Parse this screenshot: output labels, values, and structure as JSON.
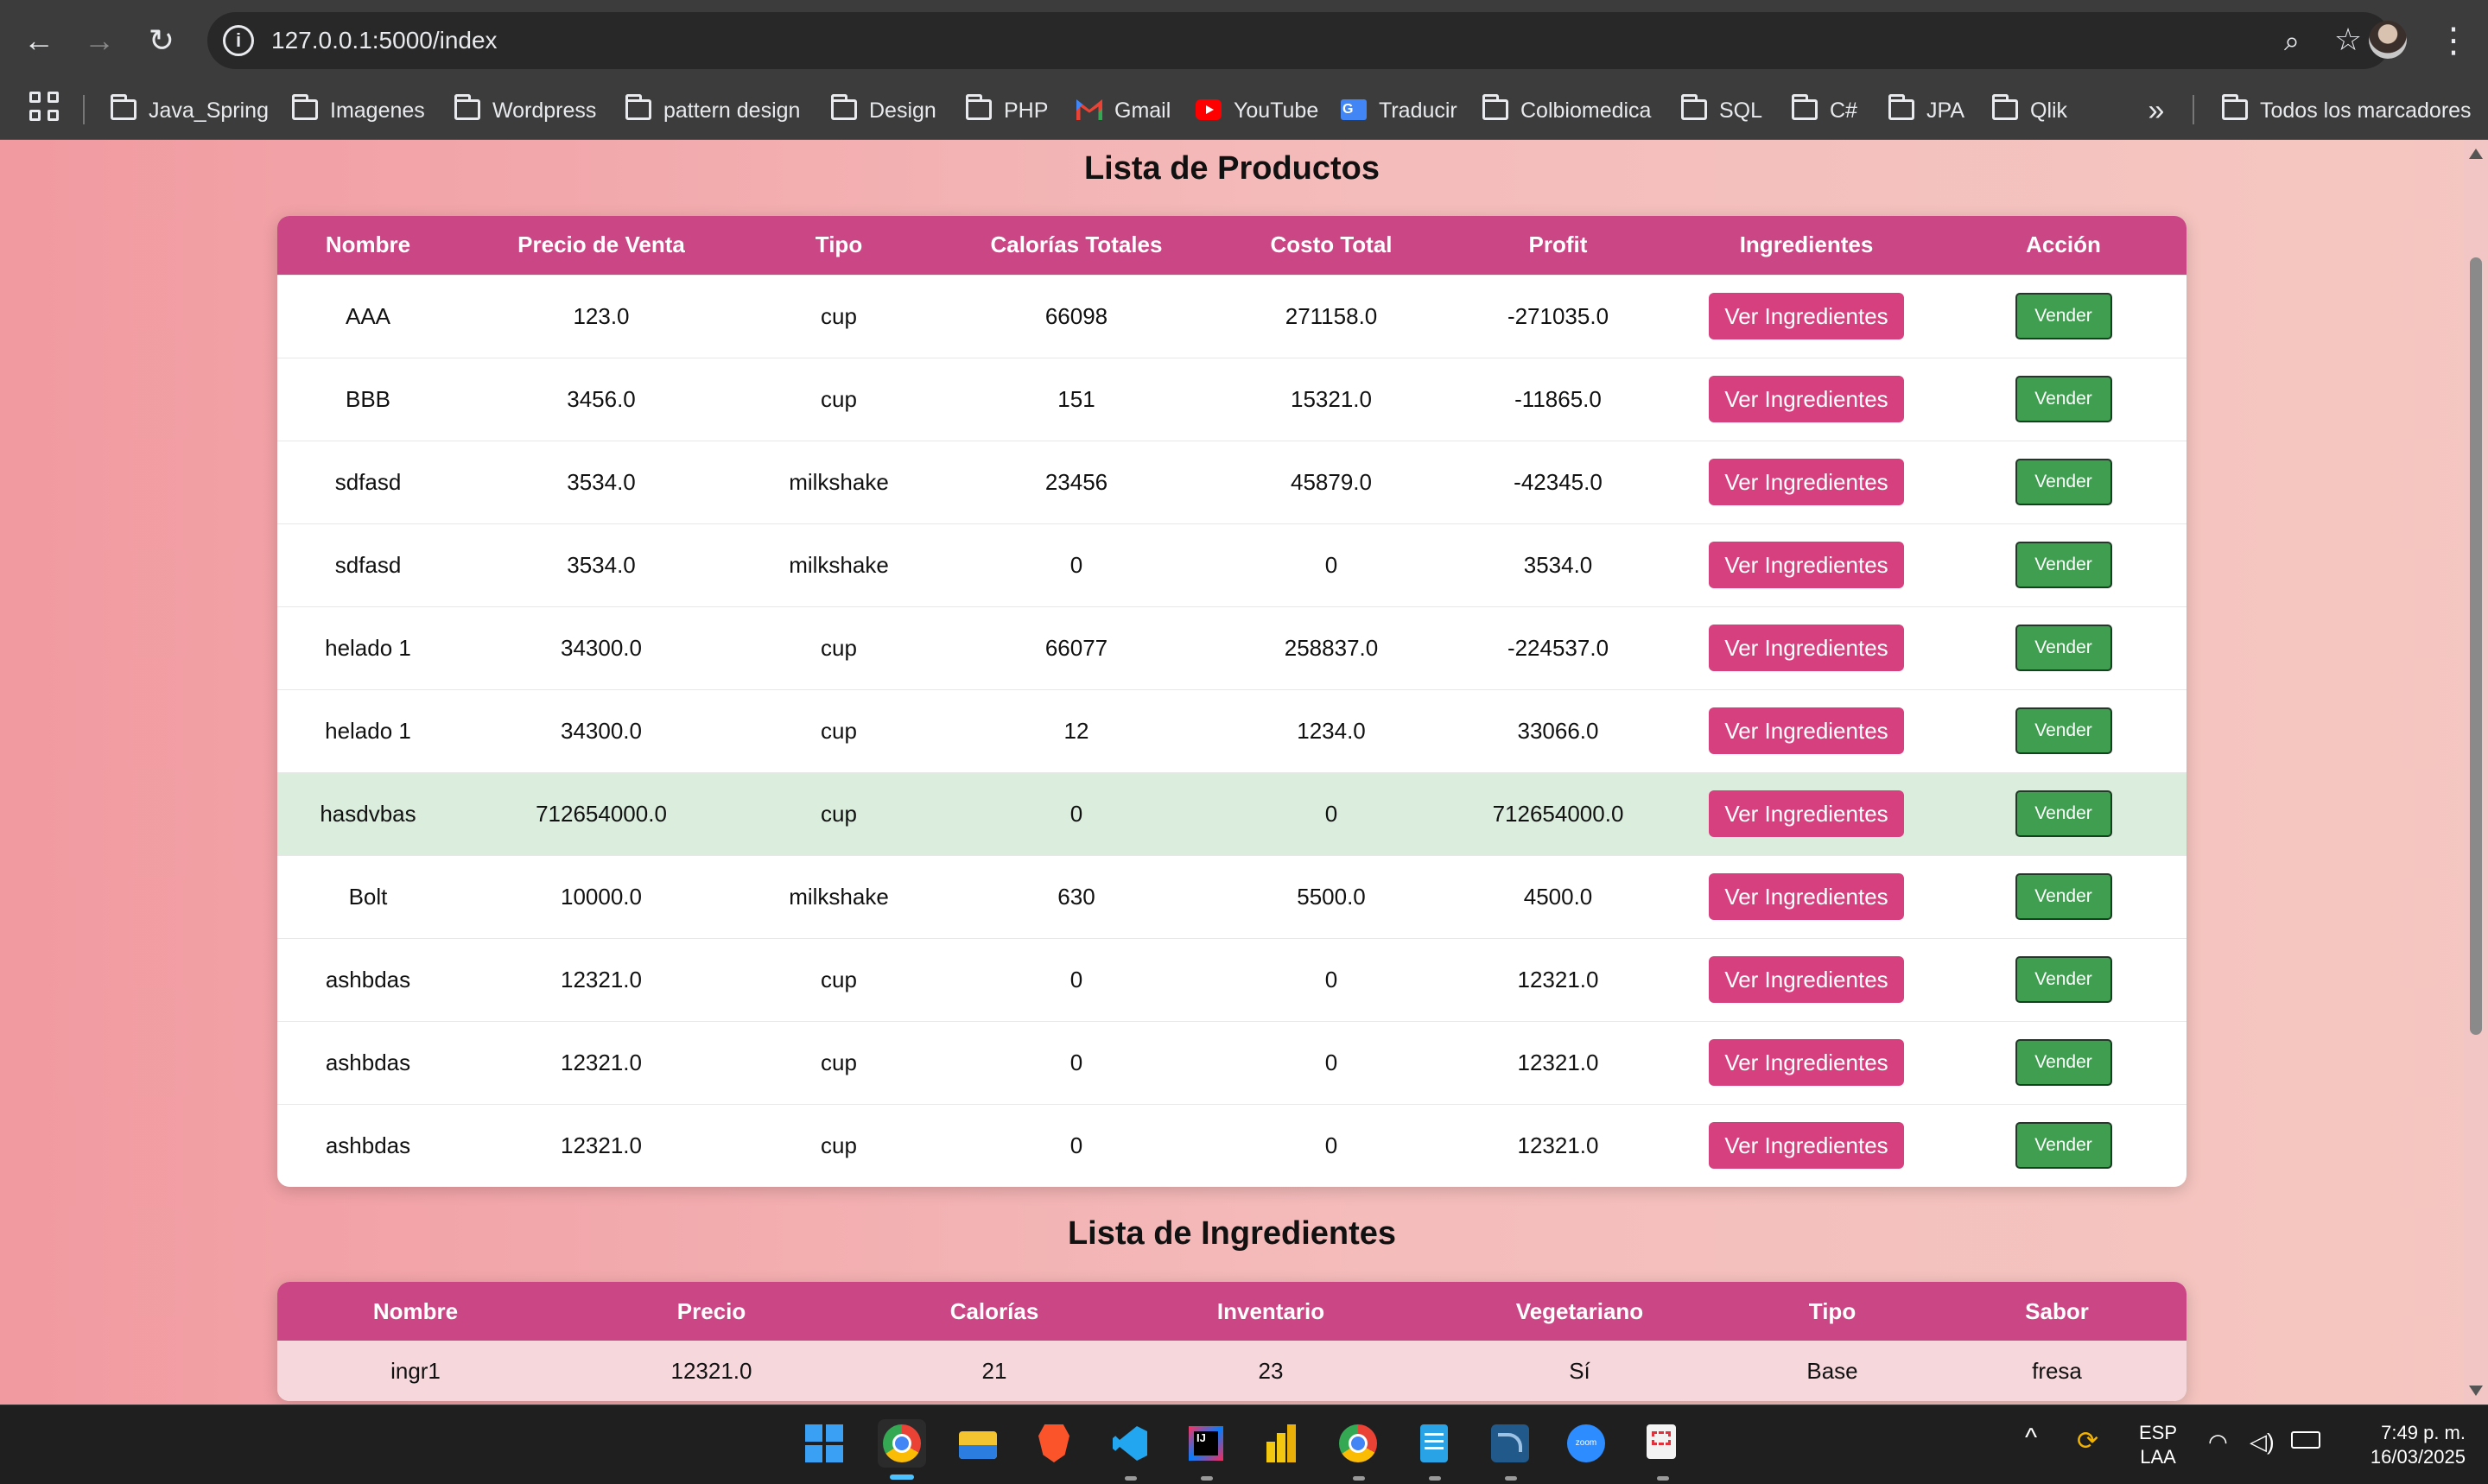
{
  "browser": {
    "url": "127.0.0.1:5000/index",
    "bookmarks": [
      {
        "label": "Java_Spring",
        "icon": "folder-icon"
      },
      {
        "label": "Imagenes",
        "icon": "folder-icon"
      },
      {
        "label": "Wordpress",
        "icon": "folder-icon"
      },
      {
        "label": "pattern design",
        "icon": "folder-icon"
      },
      {
        "label": "Design",
        "icon": "folder-icon"
      },
      {
        "label": "PHP",
        "icon": "folder-icon"
      },
      {
        "label": "Gmail",
        "icon": "gmail-icon"
      },
      {
        "label": "YouTube",
        "icon": "youtube-icon"
      },
      {
        "label": "Traducir",
        "icon": "translate-icon"
      },
      {
        "label": "Colbiomedica",
        "icon": "folder-icon"
      },
      {
        "label": "SQL",
        "icon": "folder-icon"
      },
      {
        "label": "C#",
        "icon": "folder-icon"
      },
      {
        "label": "JPA",
        "icon": "folder-icon"
      },
      {
        "label": "Qlik",
        "icon": "folder-icon"
      }
    ],
    "all_bookmarks": "Todos los marcadores"
  },
  "products": {
    "title": "Lista de Productos",
    "columns": [
      "Nombre",
      "Precio de Venta",
      "Tipo",
      "Calorías Totales",
      "Costo Total",
      "Profit",
      "Ingredientes",
      "Acción"
    ],
    "ingredients_button": "Ver Ingredientes",
    "sell_button": "Vender",
    "rows": [
      {
        "nombre": "AAA",
        "precio": "123.0",
        "tipo": "cup",
        "calorias": "66098",
        "costo": "271158.0",
        "profit": "-271035.0"
      },
      {
        "nombre": "BBB",
        "precio": "3456.0",
        "tipo": "cup",
        "calorias": "151",
        "costo": "15321.0",
        "profit": "-11865.0"
      },
      {
        "nombre": "sdfasd",
        "precio": "3534.0",
        "tipo": "milkshake",
        "calorias": "23456",
        "costo": "45879.0",
        "profit": "-42345.0"
      },
      {
        "nombre": "sdfasd",
        "precio": "3534.0",
        "tipo": "milkshake",
        "calorias": "0",
        "costo": "0",
        "profit": "3534.0"
      },
      {
        "nombre": "helado 1",
        "precio": "34300.0",
        "tipo": "cup",
        "calorias": "66077",
        "costo": "258837.0",
        "profit": "-224537.0"
      },
      {
        "nombre": "helado 1",
        "precio": "34300.0",
        "tipo": "cup",
        "calorias": "12",
        "costo": "1234.0",
        "profit": "33066.0"
      },
      {
        "nombre": "hasdvbas",
        "precio": "712654000.0",
        "tipo": "cup",
        "calorias": "0",
        "costo": "0",
        "profit": "712654000.0"
      },
      {
        "nombre": "Bolt",
        "precio": "10000.0",
        "tipo": "milkshake",
        "calorias": "630",
        "costo": "5500.0",
        "profit": "4500.0"
      },
      {
        "nombre": "ashbdas",
        "precio": "12321.0",
        "tipo": "cup",
        "calorias": "0",
        "costo": "0",
        "profit": "12321.0"
      },
      {
        "nombre": "ashbdas",
        "precio": "12321.0",
        "tipo": "cup",
        "calorias": "0",
        "costo": "0",
        "profit": "12321.0"
      },
      {
        "nombre": "ashbdas",
        "precio": "12321.0",
        "tipo": "cup",
        "calorias": "0",
        "costo": "0",
        "profit": "12321.0"
      }
    ]
  },
  "ingredients": {
    "title": "Lista de Ingredientes",
    "columns": [
      "Nombre",
      "Precio",
      "Calorías",
      "Inventario",
      "Vegetariano",
      "Tipo",
      "Sabor"
    ],
    "rows": [
      {
        "nombre": "ingr1",
        "precio": "12321.0",
        "calorias": "21",
        "inventario": "23",
        "vegetariano": "Sí",
        "tipo": "Base",
        "sabor": "fresa"
      }
    ]
  },
  "system_tray": {
    "language_top": "ESP",
    "language_bottom": "LAA",
    "time": "7:49 p. m.",
    "date": "16/03/2025"
  },
  "colors": {
    "table_header": "#cb4684",
    "ingredients_button": "#d7407f",
    "sell_button": "#3f9e50",
    "highlight_row": "#dbeedd"
  }
}
